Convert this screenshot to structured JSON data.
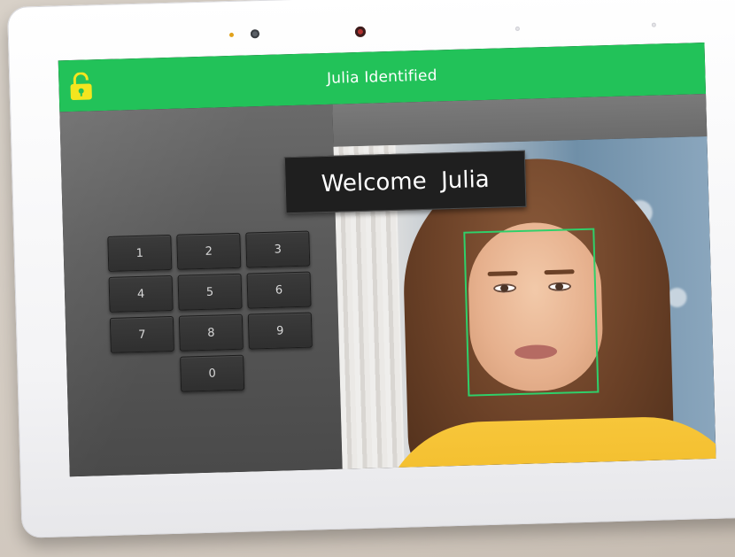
{
  "header": {
    "title": "Julia Identified",
    "lock_icon": "unlocked-padlock-icon",
    "bar_color": "#22c259",
    "icon_color": "#f4e51f"
  },
  "welcome": {
    "text": "Welcome  Julia"
  },
  "keypad": {
    "keys": [
      "1",
      "2",
      "3",
      "4",
      "5",
      "6",
      "7",
      "8",
      "9",
      "0"
    ]
  },
  "face_recognition": {
    "box_color": "#2fd06a"
  }
}
